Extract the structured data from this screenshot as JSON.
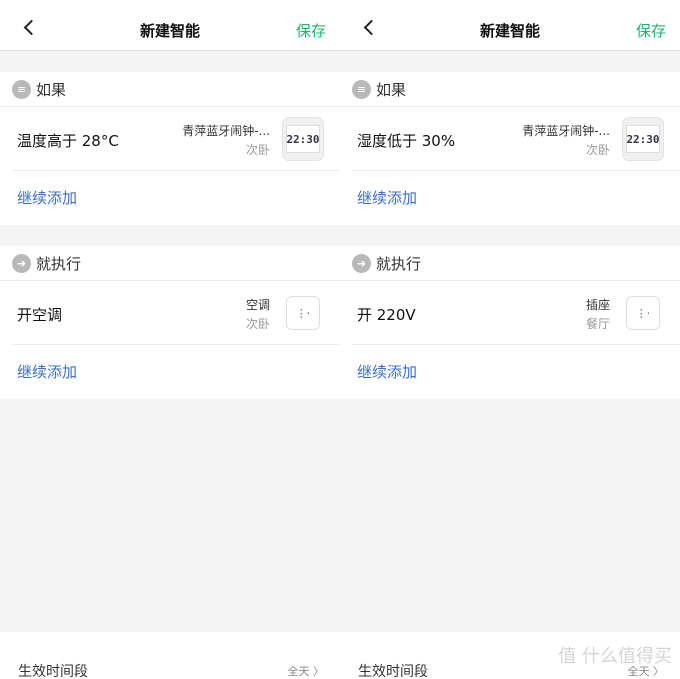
{
  "panels": [
    {
      "header": {
        "title": "新建智能",
        "save": "保存"
      },
      "if_section": {
        "title": "如果",
        "condition": "温度高于 28°C",
        "device_name": "青萍蓝牙闹钟-...",
        "device_room": "次卧",
        "device_display": "22:30",
        "add": "继续添加"
      },
      "then_section": {
        "title": "就执行",
        "action": "开空调",
        "device_name": "空调",
        "device_room": "次卧",
        "add": "继续添加"
      },
      "footer": {
        "label": "生效时间段",
        "value": "全天"
      }
    },
    {
      "header": {
        "title": "新建智能",
        "save": "保存"
      },
      "if_section": {
        "title": "如果",
        "condition": "湿度低于 30%",
        "device_name": "青萍蓝牙闹钟-...",
        "device_room": "次卧",
        "device_display": "22:30",
        "add": "继续添加"
      },
      "then_section": {
        "title": "就执行",
        "action": "开 220V",
        "device_name": "插座",
        "device_room": "餐厅",
        "add": "继续添加"
      },
      "footer": {
        "label": "生效时间段",
        "value": "全天"
      }
    }
  ],
  "watermark": "值 什么值得买",
  "colors": {
    "accent": "#20b26c",
    "link": "#3b6fc9"
  }
}
